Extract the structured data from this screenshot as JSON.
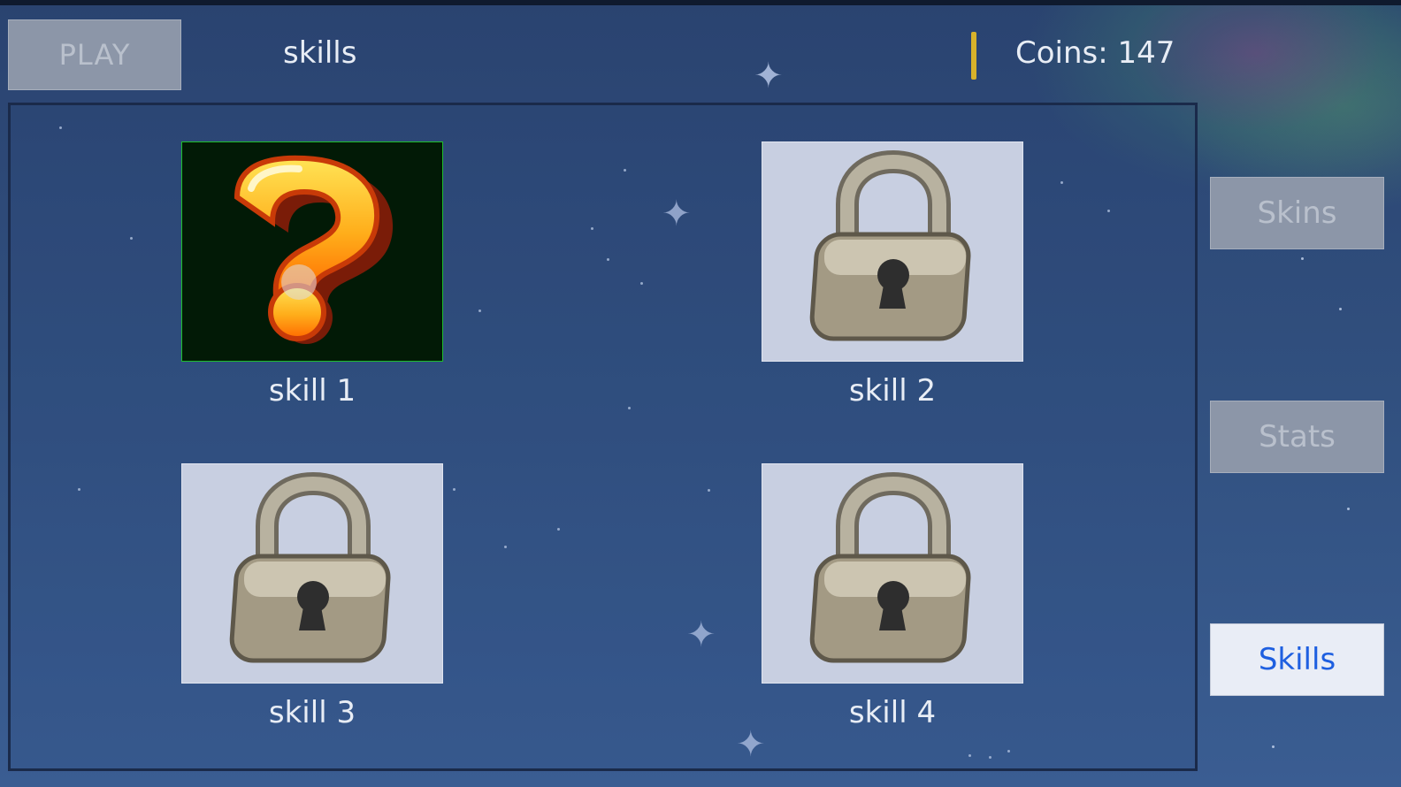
{
  "header": {
    "play_label": "PLAY",
    "screen_title": "skills",
    "coins_label": "Coins:",
    "coins_value": "147"
  },
  "skills": [
    {
      "label": "skill 1",
      "state": "unlocked",
      "icon": "question-mark-icon"
    },
    {
      "label": "skill 2",
      "state": "locked",
      "icon": "padlock-icon"
    },
    {
      "label": "skill 3",
      "state": "locked",
      "icon": "padlock-icon"
    },
    {
      "label": "skill 4",
      "state": "locked",
      "icon": "padlock-icon"
    }
  ],
  "sidebar": {
    "items": [
      {
        "label": "Skins",
        "active": false
      },
      {
        "label": "Stats",
        "active": false
      },
      {
        "label": "Skills",
        "active": true
      }
    ]
  },
  "colors": {
    "background": "#2c4670",
    "selected_border": "#1ebe2c",
    "active_tab_text": "#1e5fe0",
    "coin_bar": "#d8b22a"
  }
}
